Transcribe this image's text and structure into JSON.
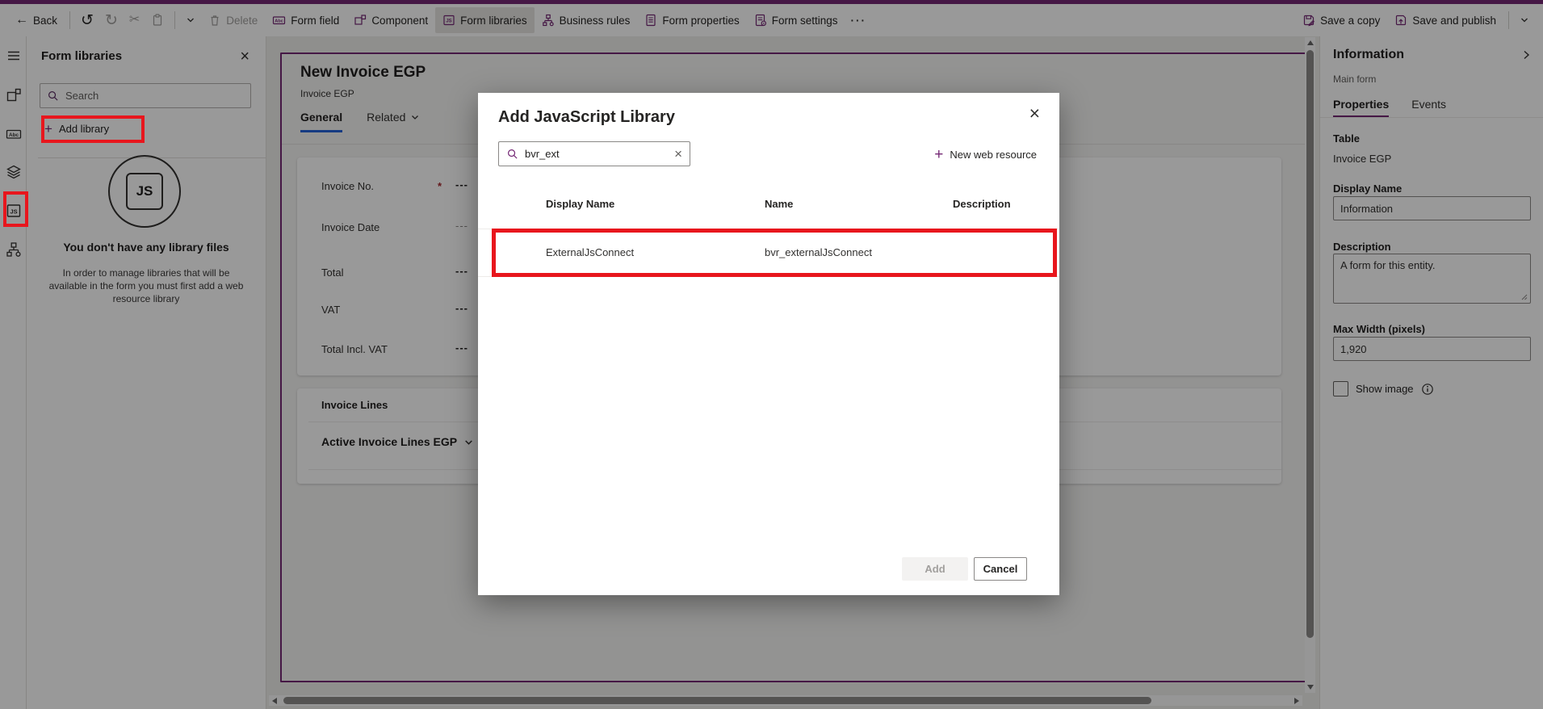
{
  "glyphs": {
    "back": "←",
    "undo": "↺",
    "redo": "↻",
    "cut": "✂",
    "overflow": "···",
    "close": "×",
    "clear": "×",
    "js": "JS"
  },
  "toolbar": {
    "back": "Back",
    "delete": "Delete",
    "form_field": "Form field",
    "component": "Component",
    "form_libraries": "Form libraries",
    "business_rules": "Business rules",
    "form_properties": "Form properties",
    "form_settings": "Form settings",
    "save_a_copy": "Save a copy",
    "save_and_publish": "Save and publish"
  },
  "left_panel": {
    "title": "Form libraries",
    "search_placeholder": "Search",
    "add_library": "Add library",
    "empty_title": "You don't have any library files",
    "empty_body": "In order to manage libraries that will be available in the form you must first add a web resource library"
  },
  "canvas": {
    "title": "New Invoice EGP",
    "subtitle": "Invoice EGP",
    "tabs": {
      "general": "General",
      "related": "Related"
    },
    "fields": [
      {
        "label": "Invoice No.",
        "required_mark": "*",
        "value": "---"
      },
      {
        "label": "Invoice Date",
        "value": "---"
      },
      {
        "label": "Total",
        "value": "---"
      },
      {
        "label": "VAT",
        "value": "---"
      },
      {
        "label": "Total Incl. VAT",
        "value": "---"
      }
    ],
    "section": {
      "title": "Invoice Lines",
      "subgrid": "Active Invoice Lines EGP"
    }
  },
  "modal": {
    "title": "Add JavaScript Library",
    "search_value": "bvr_ext",
    "new_web_resource": "New web resource",
    "columns": [
      "Display Name",
      "Name",
      "Description"
    ],
    "rows": [
      {
        "display_name": "ExternalJsConnect",
        "name": "bvr_externalJsConnect",
        "description": ""
      }
    ],
    "add": "Add",
    "cancel": "Cancel"
  },
  "right_panel": {
    "title": "Information",
    "subtitle": "Main form",
    "tabs": {
      "properties": "Properties",
      "events": "Events"
    },
    "table_label": "Table",
    "table_value": "Invoice EGP",
    "display_name_label": "Display Name",
    "display_name_value": "Information",
    "description_label": "Description",
    "description_value": "A form for this entity.",
    "max_width_label": "Max Width (pixels)",
    "max_width_value": "1,920",
    "show_image": "Show image"
  },
  "colors": {
    "accent_purple": "#742774",
    "annotation_red": "#e8161d",
    "general_tab_underline": "#2563d9",
    "dim_overlay": "rgba(0,0,0,0.40)"
  }
}
